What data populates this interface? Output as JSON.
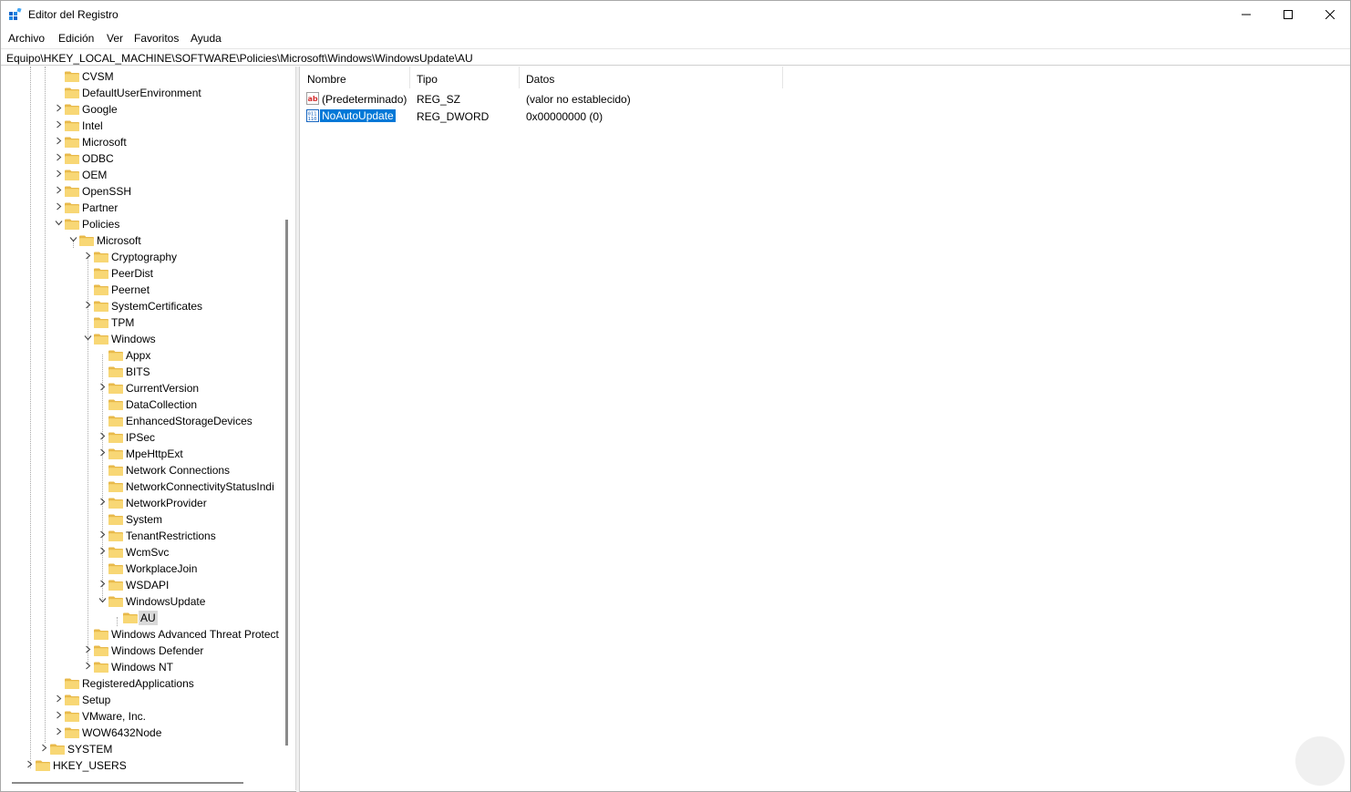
{
  "window": {
    "title": "Editor del Registro",
    "controls": [
      "minimize",
      "maximize",
      "close"
    ]
  },
  "menu": [
    "Archivo",
    "Edición",
    "Ver",
    "Favoritos",
    "Ayuda"
  ],
  "address": "Equipo\\HKEY_LOCAL_MACHINE\\SOFTWARE\\Policies\\Microsoft\\Windows\\WindowsUpdate\\AU",
  "tree": [
    {
      "label": "CVSM",
      "level": 2,
      "expander": "none"
    },
    {
      "label": "DefaultUserEnvironment",
      "level": 2,
      "expander": "none"
    },
    {
      "label": "Google",
      "level": 2,
      "expander": "collapsed"
    },
    {
      "label": "Intel",
      "level": 2,
      "expander": "collapsed"
    },
    {
      "label": "Microsoft",
      "level": 2,
      "expander": "collapsed"
    },
    {
      "label": "ODBC",
      "level": 2,
      "expander": "collapsed"
    },
    {
      "label": "OEM",
      "level": 2,
      "expander": "collapsed"
    },
    {
      "label": "OpenSSH",
      "level": 2,
      "expander": "collapsed"
    },
    {
      "label": "Partner",
      "level": 2,
      "expander": "collapsed"
    },
    {
      "label": "Policies",
      "level": 2,
      "expander": "expanded"
    },
    {
      "label": "Microsoft",
      "level": 3,
      "expander": "expanded"
    },
    {
      "label": "Cryptography",
      "level": 4,
      "expander": "collapsed"
    },
    {
      "label": "PeerDist",
      "level": 4,
      "expander": "none"
    },
    {
      "label": "Peernet",
      "level": 4,
      "expander": "none"
    },
    {
      "label": "SystemCertificates",
      "level": 4,
      "expander": "collapsed"
    },
    {
      "label": "TPM",
      "level": 4,
      "expander": "none"
    },
    {
      "label": "Windows",
      "level": 4,
      "expander": "expanded"
    },
    {
      "label": "Appx",
      "level": 5,
      "expander": "none"
    },
    {
      "label": "BITS",
      "level": 5,
      "expander": "none"
    },
    {
      "label": "CurrentVersion",
      "level": 5,
      "expander": "collapsed"
    },
    {
      "label": "DataCollection",
      "level": 5,
      "expander": "none"
    },
    {
      "label": "EnhancedStorageDevices",
      "level": 5,
      "expander": "none"
    },
    {
      "label": "IPSec",
      "level": 5,
      "expander": "collapsed"
    },
    {
      "label": "MpeHttpExt",
      "level": 5,
      "expander": "collapsed"
    },
    {
      "label": "Network Connections",
      "level": 5,
      "expander": "none"
    },
    {
      "label": "NetworkConnectivityStatusIndi",
      "level": 5,
      "expander": "none"
    },
    {
      "label": "NetworkProvider",
      "level": 5,
      "expander": "collapsed"
    },
    {
      "label": "System",
      "level": 5,
      "expander": "none"
    },
    {
      "label": "TenantRestrictions",
      "level": 5,
      "expander": "collapsed"
    },
    {
      "label": "WcmSvc",
      "level": 5,
      "expander": "collapsed"
    },
    {
      "label": "WorkplaceJoin",
      "level": 5,
      "expander": "none"
    },
    {
      "label": "WSDAPI",
      "level": 5,
      "expander": "collapsed"
    },
    {
      "label": "WindowsUpdate",
      "level": 5,
      "expander": "expanded"
    },
    {
      "label": "AU",
      "level": 6,
      "expander": "none",
      "selected": true
    },
    {
      "label": "Windows Advanced Threat Protect",
      "level": 4,
      "expander": "none"
    },
    {
      "label": "Windows Defender",
      "level": 4,
      "expander": "collapsed"
    },
    {
      "label": "Windows NT",
      "level": 4,
      "expander": "collapsed"
    },
    {
      "label": "RegisteredApplications",
      "level": 2,
      "expander": "none"
    },
    {
      "label": "Setup",
      "level": 2,
      "expander": "collapsed"
    },
    {
      "label": "VMware, Inc.",
      "level": 2,
      "expander": "collapsed"
    },
    {
      "label": "WOW6432Node",
      "level": 2,
      "expander": "collapsed"
    },
    {
      "label": "SYSTEM",
      "level": 1,
      "expander": "collapsed"
    },
    {
      "label": "HKEY_USERS",
      "level": 0,
      "expander": "collapsed"
    }
  ],
  "list": {
    "columns": [
      "Nombre",
      "Tipo",
      "Datos"
    ],
    "rows": [
      {
        "name": "(Predeterminado)",
        "type": "REG_SZ",
        "data": "(valor no establecido)",
        "icon": "string-value-icon",
        "selected": false
      },
      {
        "name": "NoAutoUpdate",
        "type": "REG_DWORD",
        "data": "0x00000000 (0)",
        "icon": "binary-value-icon",
        "selected": true
      }
    ]
  },
  "colors": {
    "folder": "#f8d775",
    "folder_dark": "#e8b94a",
    "selection": "#0078d7",
    "tree_selection": "#d9d9d9"
  }
}
